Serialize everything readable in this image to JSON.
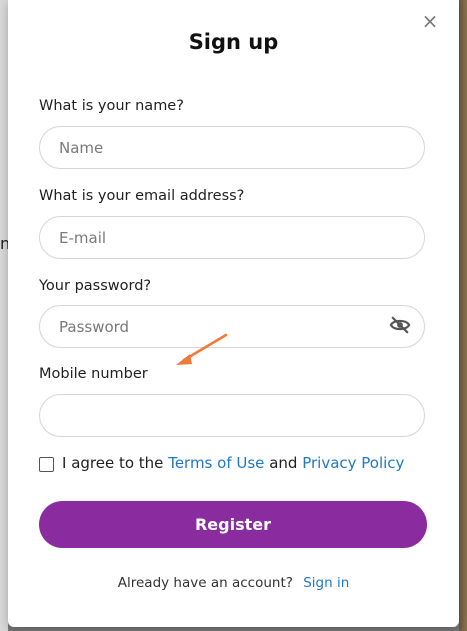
{
  "modal": {
    "title": "Sign up",
    "close_icon": "×"
  },
  "backdrop": {
    "partial_text": "n"
  },
  "form": {
    "name": {
      "label": "What is your name?",
      "placeholder": "Name",
      "value": ""
    },
    "email": {
      "label": "What is your email address?",
      "placeholder": "E-mail",
      "value": ""
    },
    "password": {
      "label": "Your password?",
      "placeholder": "Password",
      "value": "",
      "toggle_icon": "eye-slash-icon"
    },
    "mobile": {
      "label": "Mobile number",
      "placeholder": "",
      "value": ""
    },
    "agree": {
      "prefix": "I agree to the",
      "terms_link": "Terms of Use",
      "conjunction": "and",
      "privacy_link": "Privacy Policy",
      "checked": false
    },
    "register_label": "Register"
  },
  "footer": {
    "text": "Already have an account?",
    "signin_link": "Sign in"
  },
  "colors": {
    "primary": "#8a2ca0",
    "link": "#1f78c8",
    "annotation_arrow": "#f07a3a"
  }
}
